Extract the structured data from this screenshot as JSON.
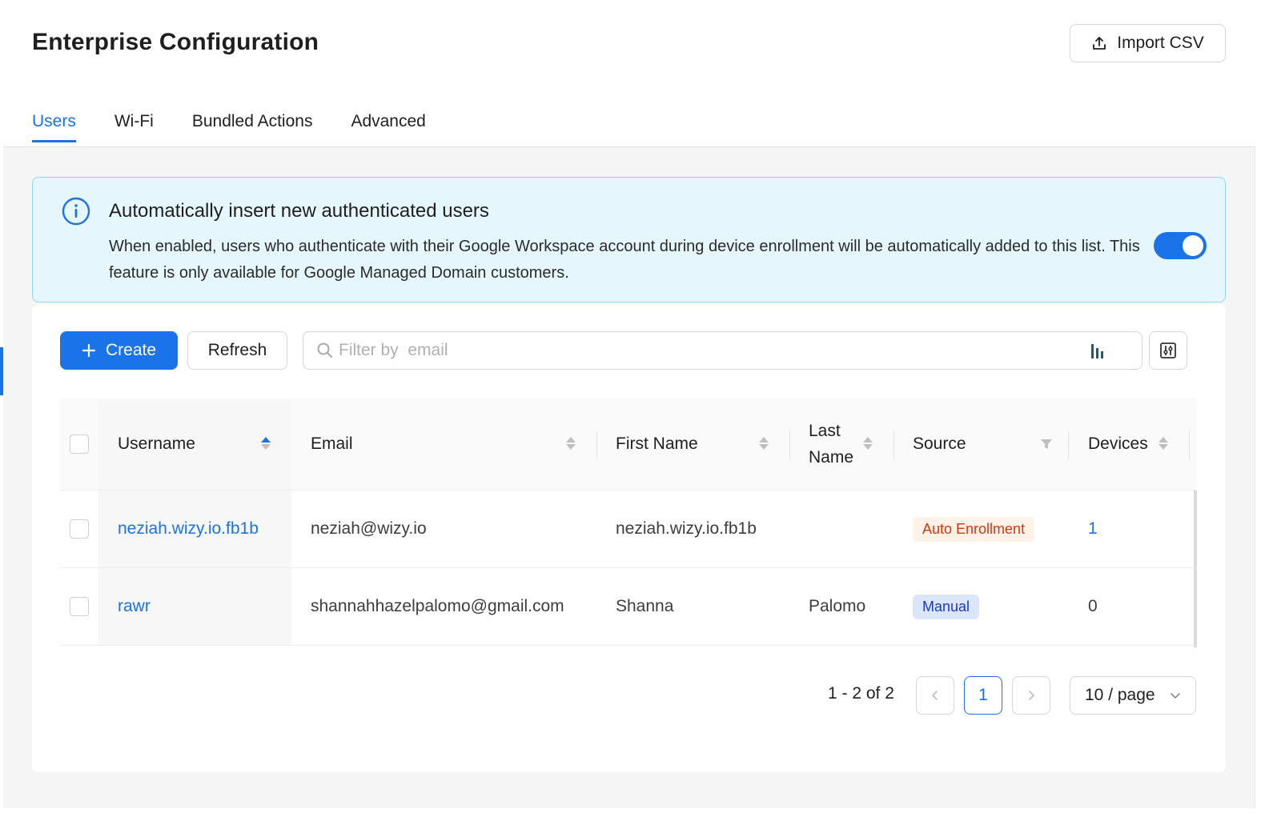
{
  "header": {
    "title": "Enterprise Configuration",
    "import_label": "Import CSV"
  },
  "tabs": [
    {
      "label": "Users",
      "active": true
    },
    {
      "label": "Wi-Fi",
      "active": false
    },
    {
      "label": "Bundled Actions",
      "active": false
    },
    {
      "label": "Advanced",
      "active": false
    }
  ],
  "banner": {
    "title": "Automatically insert new authenticated users",
    "description": "When enabled, users who authenticate with their Google Workspace account during device enrollment will be automatically added to this list. This feature is only available for Google Managed Domain customers.",
    "toggle_on": true
  },
  "toolbar": {
    "create_label": "Create",
    "refresh_label": "Refresh",
    "filter_placeholder": "Filter by  email"
  },
  "table": {
    "columns": {
      "username": "Username",
      "email": "Email",
      "first_name": "First Name",
      "last_name_line1": "Last",
      "last_name_line2": "Name",
      "source": "Source",
      "devices": "Devices"
    },
    "rows": [
      {
        "username": "neziah.wizy.io.fb1b",
        "email": "neziah@wizy.io",
        "first_name": "neziah.wizy.io.fb1b",
        "last_name": "",
        "source": "Auto Enrollment",
        "devices": "1"
      },
      {
        "username": "rawr",
        "email": "shannahhazelpalomo@gmail.com",
        "first_name": "Shanna",
        "last_name": "Palomo",
        "source": "Manual",
        "devices": "0"
      }
    ]
  },
  "pagination": {
    "summary": "1 - 2 of 2",
    "current_page": "1",
    "page_size": "10 / page"
  },
  "colors": {
    "accent": "#1a73e8",
    "banner_bg": "#e5f6fd",
    "tag_auto_text": "#d4380d",
    "tag_manual_text": "#1d39c4"
  }
}
